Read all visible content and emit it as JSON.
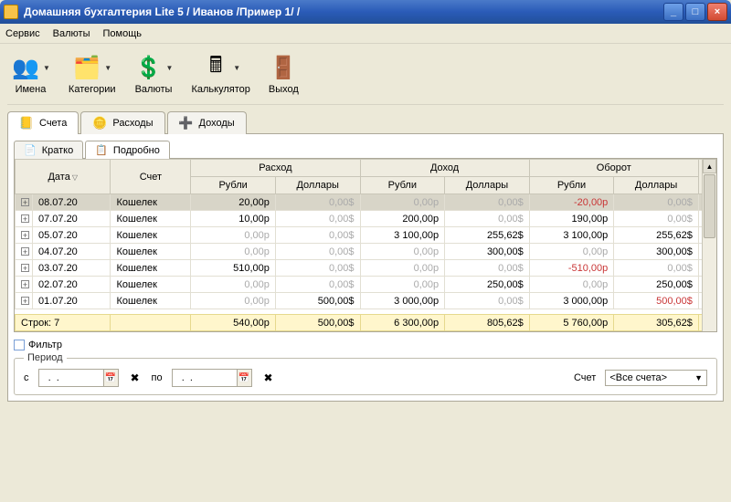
{
  "window": {
    "title": "Домашняя бухгалтерия Lite 5  / Иванов /Пример 1/ /"
  },
  "menu": {
    "service": "Сервис",
    "currencies": "Валюты",
    "help": "Помощь"
  },
  "toolbar": {
    "names": "Имена",
    "categories": "Категории",
    "currencies": "Валюты",
    "calculator": "Калькулятор",
    "exit": "Выход"
  },
  "maintabs": {
    "accounts": "Счета",
    "expenses": "Расходы",
    "incomes": "Доходы"
  },
  "subtabs": {
    "brief": "Кратко",
    "detail": "Подробно"
  },
  "grid": {
    "headers": {
      "date": "Дата",
      "account": "Счет",
      "expense": "Расход",
      "income": "Доход",
      "turnover": "Оборот",
      "rub": "Рубли",
      "usd": "Доллары"
    },
    "rows": [
      {
        "date": "08.07.20",
        "account": "Кошелек",
        "exp_rub": "20,00р",
        "exp_usd": "0,00$",
        "inc_rub": "0,00р",
        "inc_usd": "0,00$",
        "turn_rub": "-20,00р",
        "turn_usd": "0,00$",
        "sel": true,
        "gy": {
          "exp_usd": true,
          "inc_rub": true,
          "inc_usd": true,
          "turn_usd": true
        },
        "neg": {
          "turn_rub": true
        }
      },
      {
        "date": "07.07.20",
        "account": "Кошелек",
        "exp_rub": "10,00р",
        "exp_usd": "0,00$",
        "inc_rub": "200,00р",
        "inc_usd": "0,00$",
        "turn_rub": "190,00р",
        "turn_usd": "0,00$",
        "gy": {
          "exp_usd": true,
          "inc_usd": true,
          "turn_usd": true
        }
      },
      {
        "date": "05.07.20",
        "account": "Кошелек",
        "exp_rub": "0,00р",
        "exp_usd": "0,00$",
        "inc_rub": "3 100,00р",
        "inc_usd": "255,62$",
        "turn_rub": "3 100,00р",
        "turn_usd": "255,62$",
        "gy": {
          "exp_rub": true,
          "exp_usd": true
        }
      },
      {
        "date": "04.07.20",
        "account": "Кошелек",
        "exp_rub": "0,00р",
        "exp_usd": "0,00$",
        "inc_rub": "0,00р",
        "inc_usd": "300,00$",
        "turn_rub": "0,00р",
        "turn_usd": "300,00$",
        "gy": {
          "exp_rub": true,
          "exp_usd": true,
          "inc_rub": true,
          "turn_rub": true
        }
      },
      {
        "date": "03.07.20",
        "account": "Кошелек",
        "exp_rub": "510,00р",
        "exp_usd": "0,00$",
        "inc_rub": "0,00р",
        "inc_usd": "0,00$",
        "turn_rub": "-510,00р",
        "turn_usd": "0,00$",
        "gy": {
          "exp_usd": true,
          "inc_rub": true,
          "inc_usd": true,
          "turn_usd": true
        },
        "neg": {
          "turn_rub": true
        }
      },
      {
        "date": "02.07.20",
        "account": "Кошелек",
        "exp_rub": "0,00р",
        "exp_usd": "0,00$",
        "inc_rub": "0,00р",
        "inc_usd": "250,00$",
        "turn_rub": "0,00р",
        "turn_usd": "250,00$",
        "gy": {
          "exp_rub": true,
          "exp_usd": true,
          "inc_rub": true,
          "turn_rub": true
        }
      },
      {
        "date": "01.07.20",
        "account": "Кошелек",
        "exp_rub": "0,00р",
        "exp_usd": "500,00$",
        "inc_rub": "3 000,00р",
        "inc_usd": "0,00$",
        "turn_rub": "3 000,00р",
        "turn_usd": "500,00$",
        "gy": {
          "exp_rub": true,
          "inc_usd": true
        },
        "neg": {
          "turn_usd": true
        }
      }
    ],
    "summary": {
      "label": "Строк: 7",
      "exp_rub": "540,00р",
      "exp_usd": "500,00$",
      "inc_rub": "6 300,00р",
      "inc_usd": "805,62$",
      "turn_rub": "5 760,00р",
      "turn_usd": "305,62$"
    }
  },
  "filter": {
    "label": "Фильтр",
    "period_legend": "Период",
    "from": "с",
    "to": "по",
    "from_value": "  .  .    ",
    "to_value": "  .  .    ",
    "account_label": "Счет",
    "account_value": "<Все счета>"
  }
}
